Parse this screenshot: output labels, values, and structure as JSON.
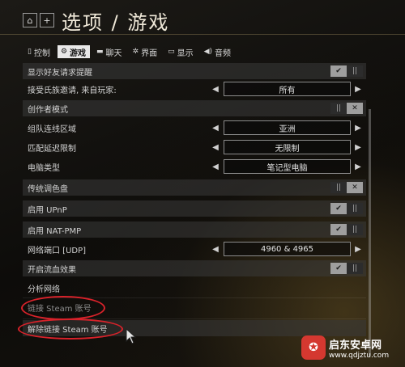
{
  "header": {
    "home_icon": "house-icon",
    "add_icon": "plus-icon",
    "title": "选项 / 游戏"
  },
  "tabs": [
    {
      "label": "控制",
      "icon": "mouse-icon",
      "active": false
    },
    {
      "label": "游戏",
      "icon": "gear-icon",
      "active": true
    },
    {
      "label": "聊天",
      "icon": "chat-icon",
      "active": false
    },
    {
      "label": "界面",
      "icon": "interface-icon",
      "active": false
    },
    {
      "label": "显示",
      "icon": "monitor-icon",
      "active": false
    },
    {
      "label": "音频",
      "icon": "speaker-icon",
      "active": false
    }
  ],
  "settings": [
    {
      "label": "显示好友请求提醒",
      "type": "toggle",
      "value": "on"
    },
    {
      "label": "接受氏族邀请, 来自玩家:",
      "type": "select",
      "value": "所有"
    },
    {
      "label": "创作者模式",
      "type": "toggle",
      "value": "off"
    },
    {
      "label": "组队连线区域",
      "type": "select",
      "value": "亚洲"
    },
    {
      "label": "匹配延迟限制",
      "type": "select",
      "value": "无限制"
    },
    {
      "label": "电脑类型",
      "type": "select",
      "value": "笔记型电脑"
    },
    {
      "label": "传统调色盘",
      "type": "toggle",
      "value": "off"
    },
    {
      "label": "启用 UPnP",
      "type": "toggle",
      "value": "on"
    },
    {
      "label": "启用 NAT-PMP",
      "type": "toggle",
      "value": "on"
    },
    {
      "label": "网络端口 [UDP]",
      "type": "select",
      "value": "4960 & 4965"
    },
    {
      "label": "开启流血效果",
      "type": "toggle",
      "value": "on"
    }
  ],
  "actions": {
    "analyze_network": "分析网络",
    "link_steam": "链接 Steam 账号",
    "unlink_steam": "解除链接 Steam 账号"
  },
  "toggle_glyphs": {
    "check": "✔",
    "bars": "||",
    "cross": "✕"
  },
  "watermark": {
    "title": "启东安卓网",
    "url": "www.qdjztu.com"
  },
  "colors": {
    "annotation_red": "#d8222a",
    "active_tab_bg": "#e8e8e8",
    "watermark_red": "#d43830"
  }
}
